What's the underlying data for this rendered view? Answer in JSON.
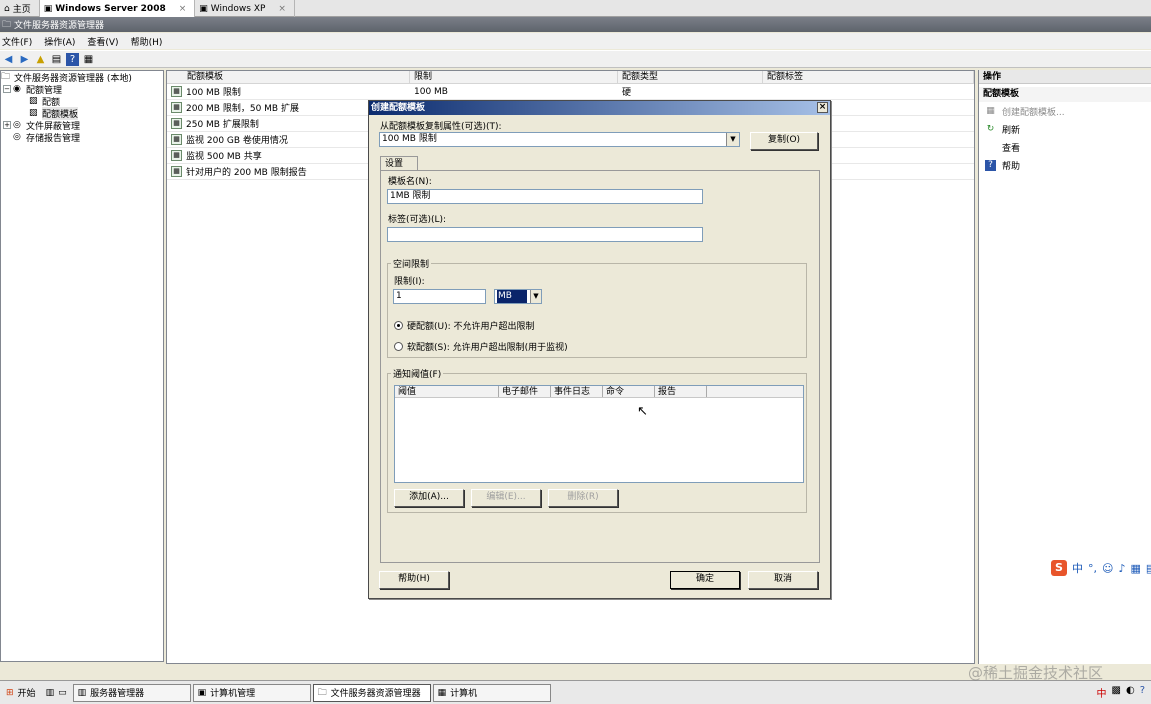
{
  "vm_tabs": [
    {
      "label": "主页",
      "active": false
    },
    {
      "label": "Windows Server 2008",
      "active": true
    },
    {
      "label": "Windows XP",
      "active": false
    }
  ],
  "window_title": "文件服务器资源管理器",
  "menu": [
    "文件(F)",
    "操作(A)",
    "查看(V)",
    "帮助(H)"
  ],
  "tree": {
    "root": "文件服务器资源管理器 (本地)",
    "quota_mgmt": "配额管理",
    "quotas": "配额",
    "quota_templates": "配额模板",
    "file_screening": "文件屏蔽管理",
    "storage_reports": "存储报告管理"
  },
  "list": {
    "headers": [
      "配额模板",
      "限制",
      "配额类型",
      "配额标签"
    ],
    "rows": [
      {
        "name": "100 MB 限制",
        "limit": "100 MB",
        "type": "硬"
      },
      {
        "name": "200 MB 限制，50 MB 扩展",
        "limit": "",
        "type": ""
      },
      {
        "name": "250 MB 扩展限制",
        "limit": "",
        "type": ""
      },
      {
        "name": "监视 200 GB 卷使用情况",
        "limit": "",
        "type": ""
      },
      {
        "name": "监视 500 MB 共享",
        "limit": "",
        "type": ""
      },
      {
        "name": "针对用户的 200 MB 限制报告",
        "limit": "",
        "type": ""
      }
    ]
  },
  "actions": {
    "header": "操作",
    "section": "配额模板",
    "items": [
      "创建配额模板...",
      "刷新",
      "查看",
      "帮助"
    ]
  },
  "dialog": {
    "title": "创建配额模板",
    "copy_from_label": "从配额模板复制属性(可选)(T):",
    "copy_from_value": "100 MB 限制",
    "copy_button": "复制(O)",
    "tab_settings": "设置",
    "template_name_label": "模板名(N):",
    "template_name_value": "1MB 限制",
    "label_label": "标签(可选)(L):",
    "label_value": "",
    "space_limit_group": "空间限制",
    "limit_label": "限制(I):",
    "limit_value": "1",
    "unit_value": "MB",
    "hard_quota": "硬配额(U): 不允许用户超出限制",
    "soft_quota": "软配额(S): 允许用户超出限制(用于监视)",
    "notify_group": "通知阈值(F)",
    "notify_headers": [
      "阈值",
      "电子邮件",
      "事件日志",
      "命令",
      "报告"
    ],
    "add_button": "添加(A)...",
    "edit_button": "编辑(E)...",
    "delete_button": "删除(R)",
    "help_button": "帮助(H)",
    "ok_button": "确定",
    "cancel_button": "取消"
  },
  "taskbar": {
    "start": "开始",
    "tasks": [
      "服务器管理器",
      "计算机管理",
      "文件服务器资源管理器",
      "计算机"
    ]
  },
  "watermark": "@稀土掘金技术社区",
  "ime_text": "中"
}
